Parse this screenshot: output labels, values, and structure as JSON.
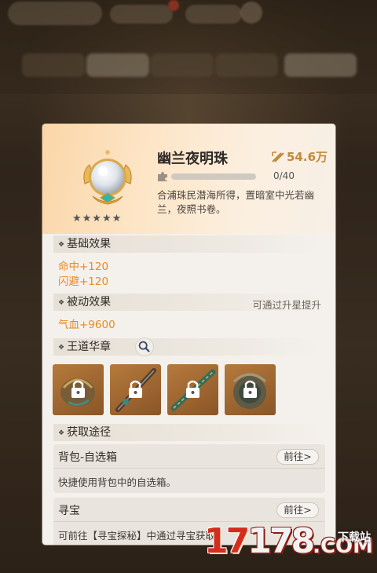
{
  "item": {
    "name": "幽兰夜明珠",
    "power": "54.6万",
    "stars": "★★★★★",
    "progress_text": "0/40",
    "progress": 0,
    "description": "合浦珠民潜海所得，置暗室中光若幽兰，夜照书卷。"
  },
  "sections": {
    "basic": {
      "title": "基础效果",
      "stats": [
        "命中+120",
        "闪避+120"
      ]
    },
    "passive": {
      "title": "被动效果",
      "note": "可通过升星提升",
      "stats": [
        "气血+9600"
      ]
    },
    "emblem": {
      "title": "王道华章"
    },
    "source": {
      "title": "获取途径"
    }
  },
  "sources": [
    {
      "title": "背包-自选箱",
      "button": "前往>",
      "desc": "快捷使用背包中的自选箱。"
    },
    {
      "title": "寻宝",
      "button": "前往>",
      "desc": "可前往【寻宝探秘】中通过寻宝获取"
    }
  ],
  "watermark": {
    "main_a": "17",
    "main_b": "178",
    "suffix": ".COM",
    "tag": "下载站"
  },
  "colors": {
    "accent_orange": "#e88a25",
    "power_gold": "#c0893a",
    "panel_bg": "#f4f1ec"
  },
  "icons": [
    "pearl-item-icon",
    "star-icon",
    "power-icon",
    "puzzle-fragment-icon",
    "search-icon",
    "lock-icon"
  ]
}
